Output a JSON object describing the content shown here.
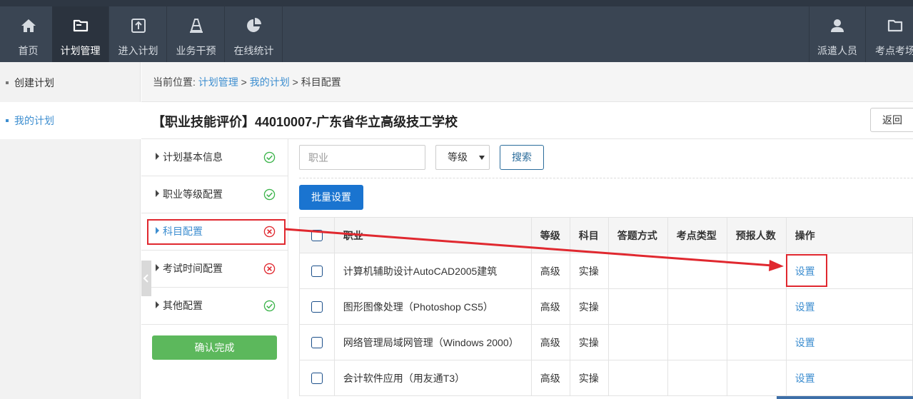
{
  "nav": {
    "items": [
      {
        "label": "首页",
        "icon": "home-icon"
      },
      {
        "label": "计划管理",
        "icon": "folder-icon",
        "active": true
      },
      {
        "label": "进入计划",
        "icon": "enter-icon"
      },
      {
        "label": "业务干预",
        "icon": "cone-icon"
      },
      {
        "label": "在线统计",
        "icon": "pie-chart-icon"
      }
    ],
    "right_items": [
      {
        "label": "派遣人员",
        "icon": "user-icon"
      },
      {
        "label": "考点考场",
        "icon": "folder-icon"
      }
    ]
  },
  "sidebar": {
    "items": [
      {
        "label": "创建计划",
        "active": false
      },
      {
        "label": "我的计划",
        "active": true
      }
    ]
  },
  "breadcrumb": {
    "prefix": "当前位置:",
    "crumb1": "计划管理",
    "sep": ">",
    "crumb2": "我的计划",
    "current": "科目配置"
  },
  "page": {
    "title": "【职业技能评价】44010007-广东省华立高级技工学校",
    "back_label": "返回"
  },
  "steps": [
    {
      "label": "计划基本信息",
      "status": "done"
    },
    {
      "label": "职业等级配置",
      "status": "done"
    },
    {
      "label": "科目配置",
      "status": "error",
      "active": true
    },
    {
      "label": "考试时间配置",
      "status": "error"
    },
    {
      "label": "其他配置",
      "status": "done"
    }
  ],
  "confirm_label": "确认完成",
  "filters": {
    "job_placeholder": "职业",
    "level_value": "等级",
    "search_label": "搜索",
    "batch_label": "批量设置"
  },
  "table": {
    "headers": [
      "职业",
      "等级",
      "科目",
      "答题方式",
      "考点类型",
      "预报人数",
      "操作"
    ],
    "rows": [
      {
        "job": "计算机辅助设计AutoCAD2005建筑",
        "level": "高级",
        "subject": "实操",
        "answer": "",
        "site_type": "",
        "count": "",
        "action": "设置"
      },
      {
        "job": "图形图像处理（Photoshop CS5）",
        "level": "高级",
        "subject": "实操",
        "answer": "",
        "site_type": "",
        "count": "",
        "action": "设置"
      },
      {
        "job": "网络管理局域网管理（Windows 2000）",
        "level": "高级",
        "subject": "实操",
        "answer": "",
        "site_type": "",
        "count": "",
        "action": "设置"
      },
      {
        "job": "会计软件应用（用友通T3）",
        "level": "高级",
        "subject": "实操",
        "answer": "",
        "site_type": "",
        "count": "",
        "action": "设置"
      }
    ]
  },
  "colors": {
    "nav_bg": "#3a4553",
    "link": "#3d8ed0",
    "primary": "#1a74d0",
    "success": "#5cb85c",
    "annotation": "#e0282f"
  }
}
